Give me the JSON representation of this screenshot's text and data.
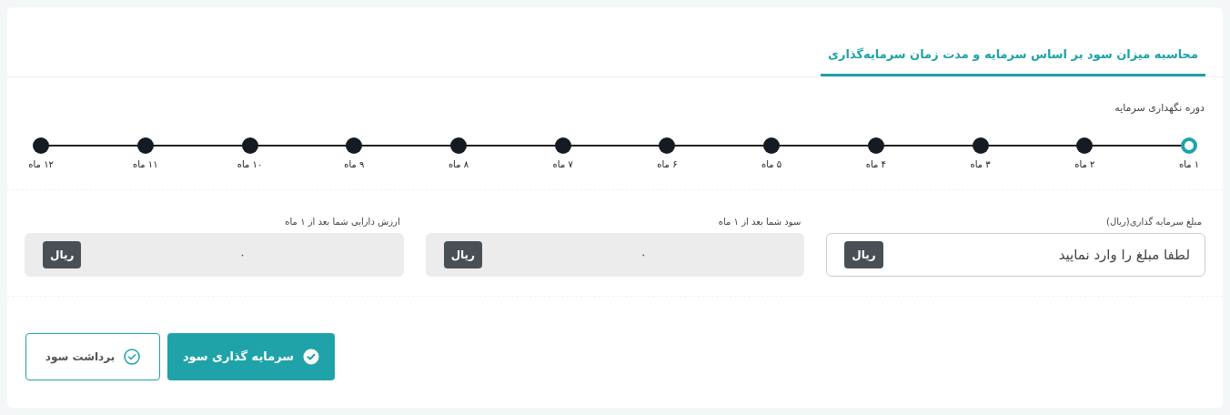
{
  "tabs": [
    {
      "label": "محاسبه میزان سود بر اساس سرمایه و مدت زمان سرمایه‌گذاری",
      "selected": true
    }
  ],
  "period": {
    "label": "دوره نگهداری سرمایه",
    "steps": [
      {
        "label": "۱ ماه",
        "selected": true
      },
      {
        "label": "۲ ماه",
        "selected": false
      },
      {
        "label": "۳ ماه",
        "selected": false
      },
      {
        "label": "۴ ماه",
        "selected": false
      },
      {
        "label": "۵ ماه",
        "selected": false
      },
      {
        "label": "۶ ماه",
        "selected": false
      },
      {
        "label": "۷ ماه",
        "selected": false
      },
      {
        "label": "۸ ماه",
        "selected": false
      },
      {
        "label": "۹ ماه",
        "selected": false
      },
      {
        "label": "۱۰ ماه",
        "selected": false
      },
      {
        "label": "۱۱ ماه",
        "selected": false
      },
      {
        "label": "۱۲ ماه",
        "selected": false
      }
    ]
  },
  "fields": [
    {
      "kind": "input",
      "label": "مبلغ سرمایه گذاری(ریال)",
      "placeholder": "لطفا مبلغ را وارد نمایید",
      "unit": "ریال"
    },
    {
      "kind": "output",
      "label": "سود شما بعد از ۱ ماه",
      "value": "۰",
      "unit": "ریال"
    },
    {
      "kind": "output",
      "label": "ارزش دارایی شما بعد از ۱ ماه",
      "value": "۰",
      "unit": "ریال"
    }
  ],
  "buttons": [
    {
      "kind": "primary",
      "label": "سرمایه گذاری سود"
    },
    {
      "kind": "outline",
      "label": "برداشت سود"
    }
  ]
}
